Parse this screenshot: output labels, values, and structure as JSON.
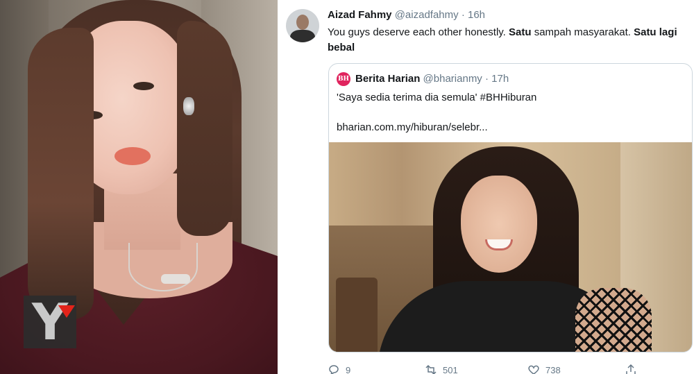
{
  "left_photo": {
    "logo_letter": "Y"
  },
  "tweet": {
    "author_name": "Aizad Fahmy",
    "author_handle": "@aizadfahmy",
    "separator": "·",
    "time": "16h",
    "text_parts": [
      {
        "t": "You guys deserve each other honestly. ",
        "bold": false
      },
      {
        "t": "Satu",
        "bold": true
      },
      {
        "t": " sampah masyarakat. ",
        "bold": false
      },
      {
        "t": "Satu lagi bebal",
        "bold": true
      }
    ]
  },
  "quote": {
    "logo_text": "BH",
    "author_name": "Berita Harian",
    "author_handle": "@bharianmy",
    "separator": "·",
    "time": "17h",
    "text": "'Saya sedia terima dia semula' #BHHiburan",
    "link": "bharian.com.my/hiburan/selebr..."
  },
  "actions": {
    "reply_count": "9",
    "retweet_count": "501",
    "like_count": "738",
    "share_count": ""
  },
  "colors": {
    "text_primary": "#14171a",
    "text_secondary": "#657786",
    "card_border": "#ccd6dd",
    "logo_red": "#e2231a"
  }
}
